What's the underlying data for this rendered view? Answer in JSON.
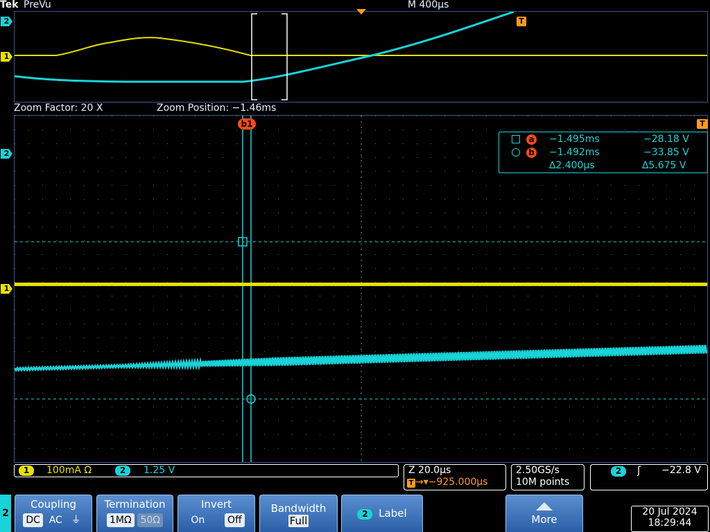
{
  "header": {
    "brand": "Tek",
    "mode": "PreVu",
    "timebase": "M 400µs"
  },
  "zoom": {
    "factor": "Zoom Factor: 20 X",
    "position": "Zoom Position: −1.46ms"
  },
  "markers": {
    "ch1": "1",
    "ch2": "2",
    "trigger": "T",
    "cursor_b": "b"
  },
  "cursors": {
    "a_label": "a",
    "a_time": "−1.495ms",
    "a_volt": "−28.18 V",
    "b_label": "b",
    "b_time": "−1.492ms",
    "b_volt": "−33.85 V",
    "delta_time": "∆2.400µs",
    "delta_volt": "∆5.675 V"
  },
  "channels": {
    "ch1_num": "1",
    "ch1_scale": "100mA Ω",
    "ch2_num": "2",
    "ch2_scale": "1.25 V"
  },
  "horizontal": {
    "zoom_scale": "Z 20.0µs",
    "position": "→▾−925.000µs",
    "sample_rate": "2.50GS/s",
    "record_length": "10M points"
  },
  "trigger": {
    "source": "2",
    "slope": "ʃ",
    "level": "−22.8 V"
  },
  "menu": {
    "channel": "2",
    "coupling_title": "Coupling",
    "coupling_opts": [
      "DC",
      "AC",
      "⏚"
    ],
    "termination_title": "Termination",
    "termination_opts": [
      "1MΩ",
      "50Ω"
    ],
    "invert_title": "Invert",
    "invert_opts": [
      "On",
      "Off"
    ],
    "bandwidth_title": "Bandwidth",
    "bandwidth_value": "Full",
    "label_num": "2",
    "label_title": "Label",
    "more_title": "More"
  },
  "datetime": {
    "date": "20 Jul  2024",
    "time": "18:29:44"
  },
  "colors": {
    "ch1": "#e8e000",
    "ch2": "#19d3d8",
    "cursor": "#ff4b14",
    "trigger": "#ff9a1a",
    "menu": "#2a5fa8"
  }
}
